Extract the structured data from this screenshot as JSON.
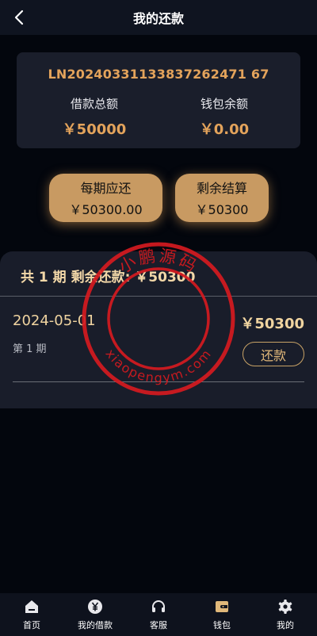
{
  "header": {
    "title": "我的还款"
  },
  "summary": {
    "loan_no": "LN20240331133837262471 67",
    "loan_total_label": "借款总额",
    "loan_total_value": "￥50000",
    "wallet_label": "钱包余额",
    "wallet_value": "￥0.00"
  },
  "pills": {
    "per_period_label": "每期应还",
    "per_period_value": "￥50300.00",
    "remaining_label": "剩余结算",
    "remaining_value": "￥50300"
  },
  "schedule": {
    "header": "共 1 期 剩余还款: ￥50300",
    "rows": [
      {
        "date": "2024-05-01",
        "amount": "￥50300",
        "period": "第 1 期",
        "button": "还款"
      }
    ]
  },
  "watermark": {
    "top_text": "小鹏源码",
    "bottom_text": "xiaopengym.com",
    "color": "#d51a1f"
  },
  "tabbar": {
    "items": [
      {
        "label": "首页",
        "icon": "home-icon"
      },
      {
        "label": "我的借款",
        "icon": "yen-coin-icon"
      },
      {
        "label": "客服",
        "icon": "headset-icon"
      },
      {
        "label": "钱包",
        "icon": "wallet-icon"
      },
      {
        "label": "我的",
        "icon": "gear-icon"
      }
    ]
  },
  "colors": {
    "accent": "#e3a35b",
    "pill": "#c89a62",
    "card": "#1a1e2b",
    "background": "#03060d"
  }
}
